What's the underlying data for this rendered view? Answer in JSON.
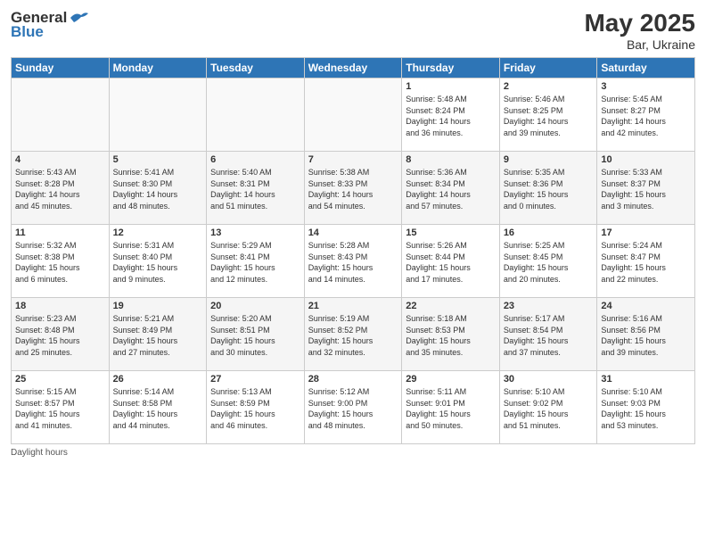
{
  "header": {
    "logo_general": "General",
    "logo_blue": "Blue",
    "month": "May 2025",
    "location": "Bar, Ukraine"
  },
  "days_of_week": [
    "Sunday",
    "Monday",
    "Tuesday",
    "Wednesday",
    "Thursday",
    "Friday",
    "Saturday"
  ],
  "footer": {
    "daylight_label": "Daylight hours"
  },
  "weeks": [
    [
      {
        "day": "",
        "info": ""
      },
      {
        "day": "",
        "info": ""
      },
      {
        "day": "",
        "info": ""
      },
      {
        "day": "",
        "info": ""
      },
      {
        "day": "1",
        "info": "Sunrise: 5:48 AM\nSunset: 8:24 PM\nDaylight: 14 hours\nand 36 minutes."
      },
      {
        "day": "2",
        "info": "Sunrise: 5:46 AM\nSunset: 8:25 PM\nDaylight: 14 hours\nand 39 minutes."
      },
      {
        "day": "3",
        "info": "Sunrise: 5:45 AM\nSunset: 8:27 PM\nDaylight: 14 hours\nand 42 minutes."
      }
    ],
    [
      {
        "day": "4",
        "info": "Sunrise: 5:43 AM\nSunset: 8:28 PM\nDaylight: 14 hours\nand 45 minutes."
      },
      {
        "day": "5",
        "info": "Sunrise: 5:41 AM\nSunset: 8:30 PM\nDaylight: 14 hours\nand 48 minutes."
      },
      {
        "day": "6",
        "info": "Sunrise: 5:40 AM\nSunset: 8:31 PM\nDaylight: 14 hours\nand 51 minutes."
      },
      {
        "day": "7",
        "info": "Sunrise: 5:38 AM\nSunset: 8:33 PM\nDaylight: 14 hours\nand 54 minutes."
      },
      {
        "day": "8",
        "info": "Sunrise: 5:36 AM\nSunset: 8:34 PM\nDaylight: 14 hours\nand 57 minutes."
      },
      {
        "day": "9",
        "info": "Sunrise: 5:35 AM\nSunset: 8:36 PM\nDaylight: 15 hours\nand 0 minutes."
      },
      {
        "day": "10",
        "info": "Sunrise: 5:33 AM\nSunset: 8:37 PM\nDaylight: 15 hours\nand 3 minutes."
      }
    ],
    [
      {
        "day": "11",
        "info": "Sunrise: 5:32 AM\nSunset: 8:38 PM\nDaylight: 15 hours\nand 6 minutes."
      },
      {
        "day": "12",
        "info": "Sunrise: 5:31 AM\nSunset: 8:40 PM\nDaylight: 15 hours\nand 9 minutes."
      },
      {
        "day": "13",
        "info": "Sunrise: 5:29 AM\nSunset: 8:41 PM\nDaylight: 15 hours\nand 12 minutes."
      },
      {
        "day": "14",
        "info": "Sunrise: 5:28 AM\nSunset: 8:43 PM\nDaylight: 15 hours\nand 14 minutes."
      },
      {
        "day": "15",
        "info": "Sunrise: 5:26 AM\nSunset: 8:44 PM\nDaylight: 15 hours\nand 17 minutes."
      },
      {
        "day": "16",
        "info": "Sunrise: 5:25 AM\nSunset: 8:45 PM\nDaylight: 15 hours\nand 20 minutes."
      },
      {
        "day": "17",
        "info": "Sunrise: 5:24 AM\nSunset: 8:47 PM\nDaylight: 15 hours\nand 22 minutes."
      }
    ],
    [
      {
        "day": "18",
        "info": "Sunrise: 5:23 AM\nSunset: 8:48 PM\nDaylight: 15 hours\nand 25 minutes."
      },
      {
        "day": "19",
        "info": "Sunrise: 5:21 AM\nSunset: 8:49 PM\nDaylight: 15 hours\nand 27 minutes."
      },
      {
        "day": "20",
        "info": "Sunrise: 5:20 AM\nSunset: 8:51 PM\nDaylight: 15 hours\nand 30 minutes."
      },
      {
        "day": "21",
        "info": "Sunrise: 5:19 AM\nSunset: 8:52 PM\nDaylight: 15 hours\nand 32 minutes."
      },
      {
        "day": "22",
        "info": "Sunrise: 5:18 AM\nSunset: 8:53 PM\nDaylight: 15 hours\nand 35 minutes."
      },
      {
        "day": "23",
        "info": "Sunrise: 5:17 AM\nSunset: 8:54 PM\nDaylight: 15 hours\nand 37 minutes."
      },
      {
        "day": "24",
        "info": "Sunrise: 5:16 AM\nSunset: 8:56 PM\nDaylight: 15 hours\nand 39 minutes."
      }
    ],
    [
      {
        "day": "25",
        "info": "Sunrise: 5:15 AM\nSunset: 8:57 PM\nDaylight: 15 hours\nand 41 minutes."
      },
      {
        "day": "26",
        "info": "Sunrise: 5:14 AM\nSunset: 8:58 PM\nDaylight: 15 hours\nand 44 minutes."
      },
      {
        "day": "27",
        "info": "Sunrise: 5:13 AM\nSunset: 8:59 PM\nDaylight: 15 hours\nand 46 minutes."
      },
      {
        "day": "28",
        "info": "Sunrise: 5:12 AM\nSunset: 9:00 PM\nDaylight: 15 hours\nand 48 minutes."
      },
      {
        "day": "29",
        "info": "Sunrise: 5:11 AM\nSunset: 9:01 PM\nDaylight: 15 hours\nand 50 minutes."
      },
      {
        "day": "30",
        "info": "Sunrise: 5:10 AM\nSunset: 9:02 PM\nDaylight: 15 hours\nand 51 minutes."
      },
      {
        "day": "31",
        "info": "Sunrise: 5:10 AM\nSunset: 9:03 PM\nDaylight: 15 hours\nand 53 minutes."
      }
    ]
  ]
}
